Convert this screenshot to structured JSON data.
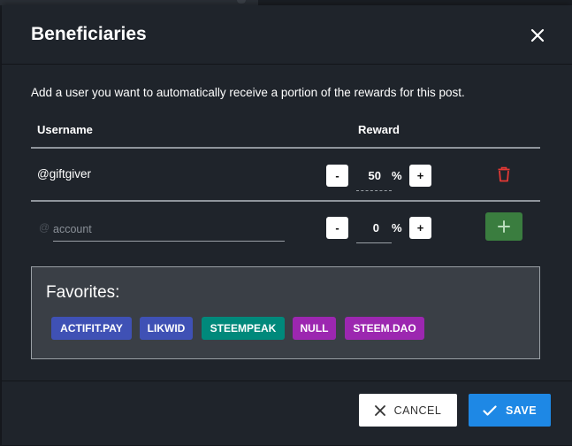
{
  "modal": {
    "title": "Beneficiaries",
    "description": "Add a user you want to automatically receive a portion of the rewards for this post."
  },
  "table": {
    "col_username": "Username",
    "col_reward": "Reward"
  },
  "beneficiary": {
    "username": "@giftgiver",
    "minus": "-",
    "plus": "+",
    "value": "50",
    "percent": "%"
  },
  "new_row": {
    "at": "@",
    "placeholder": "account",
    "minus": "-",
    "plus": "+",
    "value": "0",
    "percent": "%",
    "add": "+"
  },
  "favorites": {
    "title": "Favorites:",
    "chips": [
      {
        "label": "ACTIFIT.PAY",
        "color": "#3f51b5"
      },
      {
        "label": "LIKWID",
        "color": "#3f51b5"
      },
      {
        "label": "STEEMPEAK",
        "color": "#00897b"
      },
      {
        "label": "NULL",
        "color": "#9c27b0"
      },
      {
        "label": "STEEM.DAO",
        "color": "#9c27b0"
      }
    ]
  },
  "footer": {
    "cancel": "CANCEL",
    "save": "SAVE"
  },
  "colors": {
    "delete": "#e53935",
    "add": "#3a7d3f",
    "save": "#1e88e5"
  }
}
